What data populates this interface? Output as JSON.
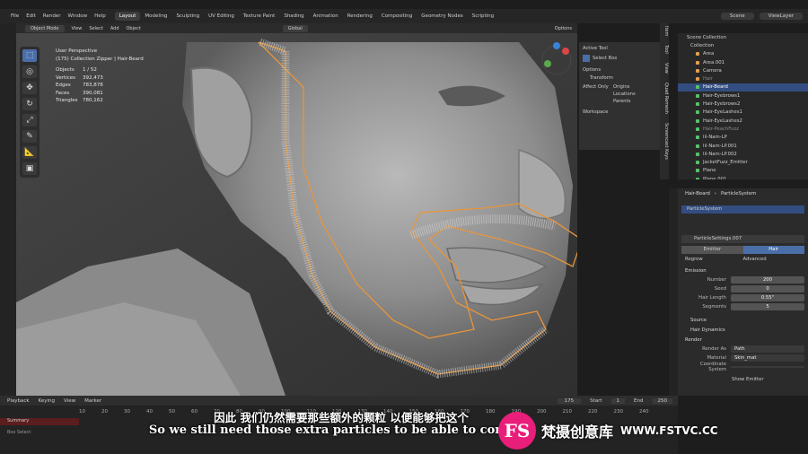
{
  "topbar": {
    "menu": [
      "File",
      "Edit",
      "Render",
      "Window",
      "Help"
    ],
    "workspaces": [
      "Layout",
      "Modeling",
      "Sculpting",
      "UV Editing",
      "Texture Paint",
      "Shading",
      "Animation",
      "Rendering",
      "Compositing",
      "Geometry Nodes",
      "Scripting"
    ],
    "active_workspace": "Layout",
    "scene": "Scene",
    "view_layer": "ViewLayer"
  },
  "viewport_header": {
    "mode": "Object Mode",
    "menus": [
      "View",
      "Select",
      "Add",
      "Object"
    ],
    "orientation": "Global",
    "options": "Options"
  },
  "stats": {
    "view": "User Perspective",
    "collection": "(175) Collection Zipper | Hair-Beard",
    "rows": [
      {
        "label": "Objects",
        "value": "1 / 52"
      },
      {
        "label": "Vertices",
        "value": "392,473"
      },
      {
        "label": "Edges",
        "value": "783,878"
      },
      {
        "label": "Faces",
        "value": "390,081"
      },
      {
        "label": "Triangles",
        "value": "780,162"
      }
    ]
  },
  "npanel": {
    "active_tool": "Active Tool",
    "select_box": "Select Box",
    "options": "Options",
    "transform": "Transform",
    "affect_only": "Affect Only",
    "origins": "Origins",
    "locations": "Locations",
    "parents": "Parents",
    "workspace": "Workspace",
    "tabs": [
      "Item",
      "Tool",
      "View",
      "Quad Remesh",
      "Screencast Keys"
    ]
  },
  "outliner": {
    "scene_collection": "Scene Collection",
    "collection": "Collection",
    "items": [
      {
        "label": "Area",
        "selected": false,
        "dim": false
      },
      {
        "label": "Area.001",
        "selected": false,
        "dim": false
      },
      {
        "label": "Camera",
        "selected": false,
        "dim": false
      },
      {
        "label": "Hair",
        "selected": false,
        "dim": true
      },
      {
        "label": "Hair-Beard",
        "selected": true,
        "dim": false
      },
      {
        "label": "Hair-Eyebrows1",
        "selected": false,
        "dim": false
      },
      {
        "label": "Hair-Eyebrows2",
        "selected": false,
        "dim": false
      },
      {
        "label": "Hair-EyeLashes1",
        "selected": false,
        "dim": false
      },
      {
        "label": "Hair-EyeLashes2",
        "selected": false,
        "dim": false
      },
      {
        "label": "Hair-PeachFuzz",
        "selected": false,
        "dim": true
      },
      {
        "label": "lil-Nam-LP",
        "selected": false,
        "dim": false
      },
      {
        "label": "lil-Nam-LP.001",
        "selected": false,
        "dim": false
      },
      {
        "label": "lil-Nam-LP.002",
        "selected": false,
        "dim": false
      },
      {
        "label": "JacketFuzz_Emitter",
        "selected": false,
        "dim": false
      },
      {
        "label": "Plane",
        "selected": false,
        "dim": false
      },
      {
        "label": "Plane.001",
        "selected": false,
        "dim": false
      }
    ]
  },
  "properties": {
    "breadcrumb_object": "Hair-Beard",
    "breadcrumb_system": "ParticleSystem",
    "system_list_item": "ParticleSystem",
    "settings": "ParticleSettings.007",
    "type_emitter": "Emitter",
    "type_hair": "Hair",
    "regrow": "Regrow",
    "advanced": "Advanced",
    "emission": "Emission",
    "number_label": "Number",
    "number": "200",
    "seed_label": "Seed",
    "seed": "0",
    "hair_length_label": "Hair Length",
    "hair_length": "0.55\"",
    "segments_label": "Segments",
    "segments": "5",
    "source": "Source",
    "hair_dynamics": "Hair Dynamics",
    "render": "Render",
    "render_as_label": "Render As",
    "render_as": "Path",
    "material_label": "Material",
    "material": "Skin_mat",
    "coord_label": "Coordinate System",
    "show_emitter": "Show Emitter"
  },
  "timeline": {
    "menus": [
      "Playback",
      "Keying",
      "View",
      "Marker"
    ],
    "frame_numbers": [
      "10",
      "20",
      "30",
      "40",
      "50",
      "60",
      "70",
      "80",
      "90",
      "100",
      "110",
      "120",
      "130",
      "140",
      "150",
      "160",
      "170",
      "180",
      "190",
      "200",
      "210",
      "220",
      "230",
      "240"
    ],
    "current_frame": "175",
    "start_label": "Start",
    "start": "1",
    "end_label": "End",
    "end": "250",
    "summary": "Summary",
    "status": "Box Select"
  },
  "subtitles": {
    "zh": "因此 我们仍然需要那些额外的颗粒 以便能够把这个",
    "en": "So we still need those extra particles to be able to comb th"
  },
  "watermark": {
    "logo": "FS",
    "name": "梵摄创意库",
    "url": "WWW.FSTVC.CC"
  },
  "colors": {
    "accent": "#4a6fa8",
    "selection_outline": "#e8953a",
    "watermark_pink": "#e91e7a"
  }
}
